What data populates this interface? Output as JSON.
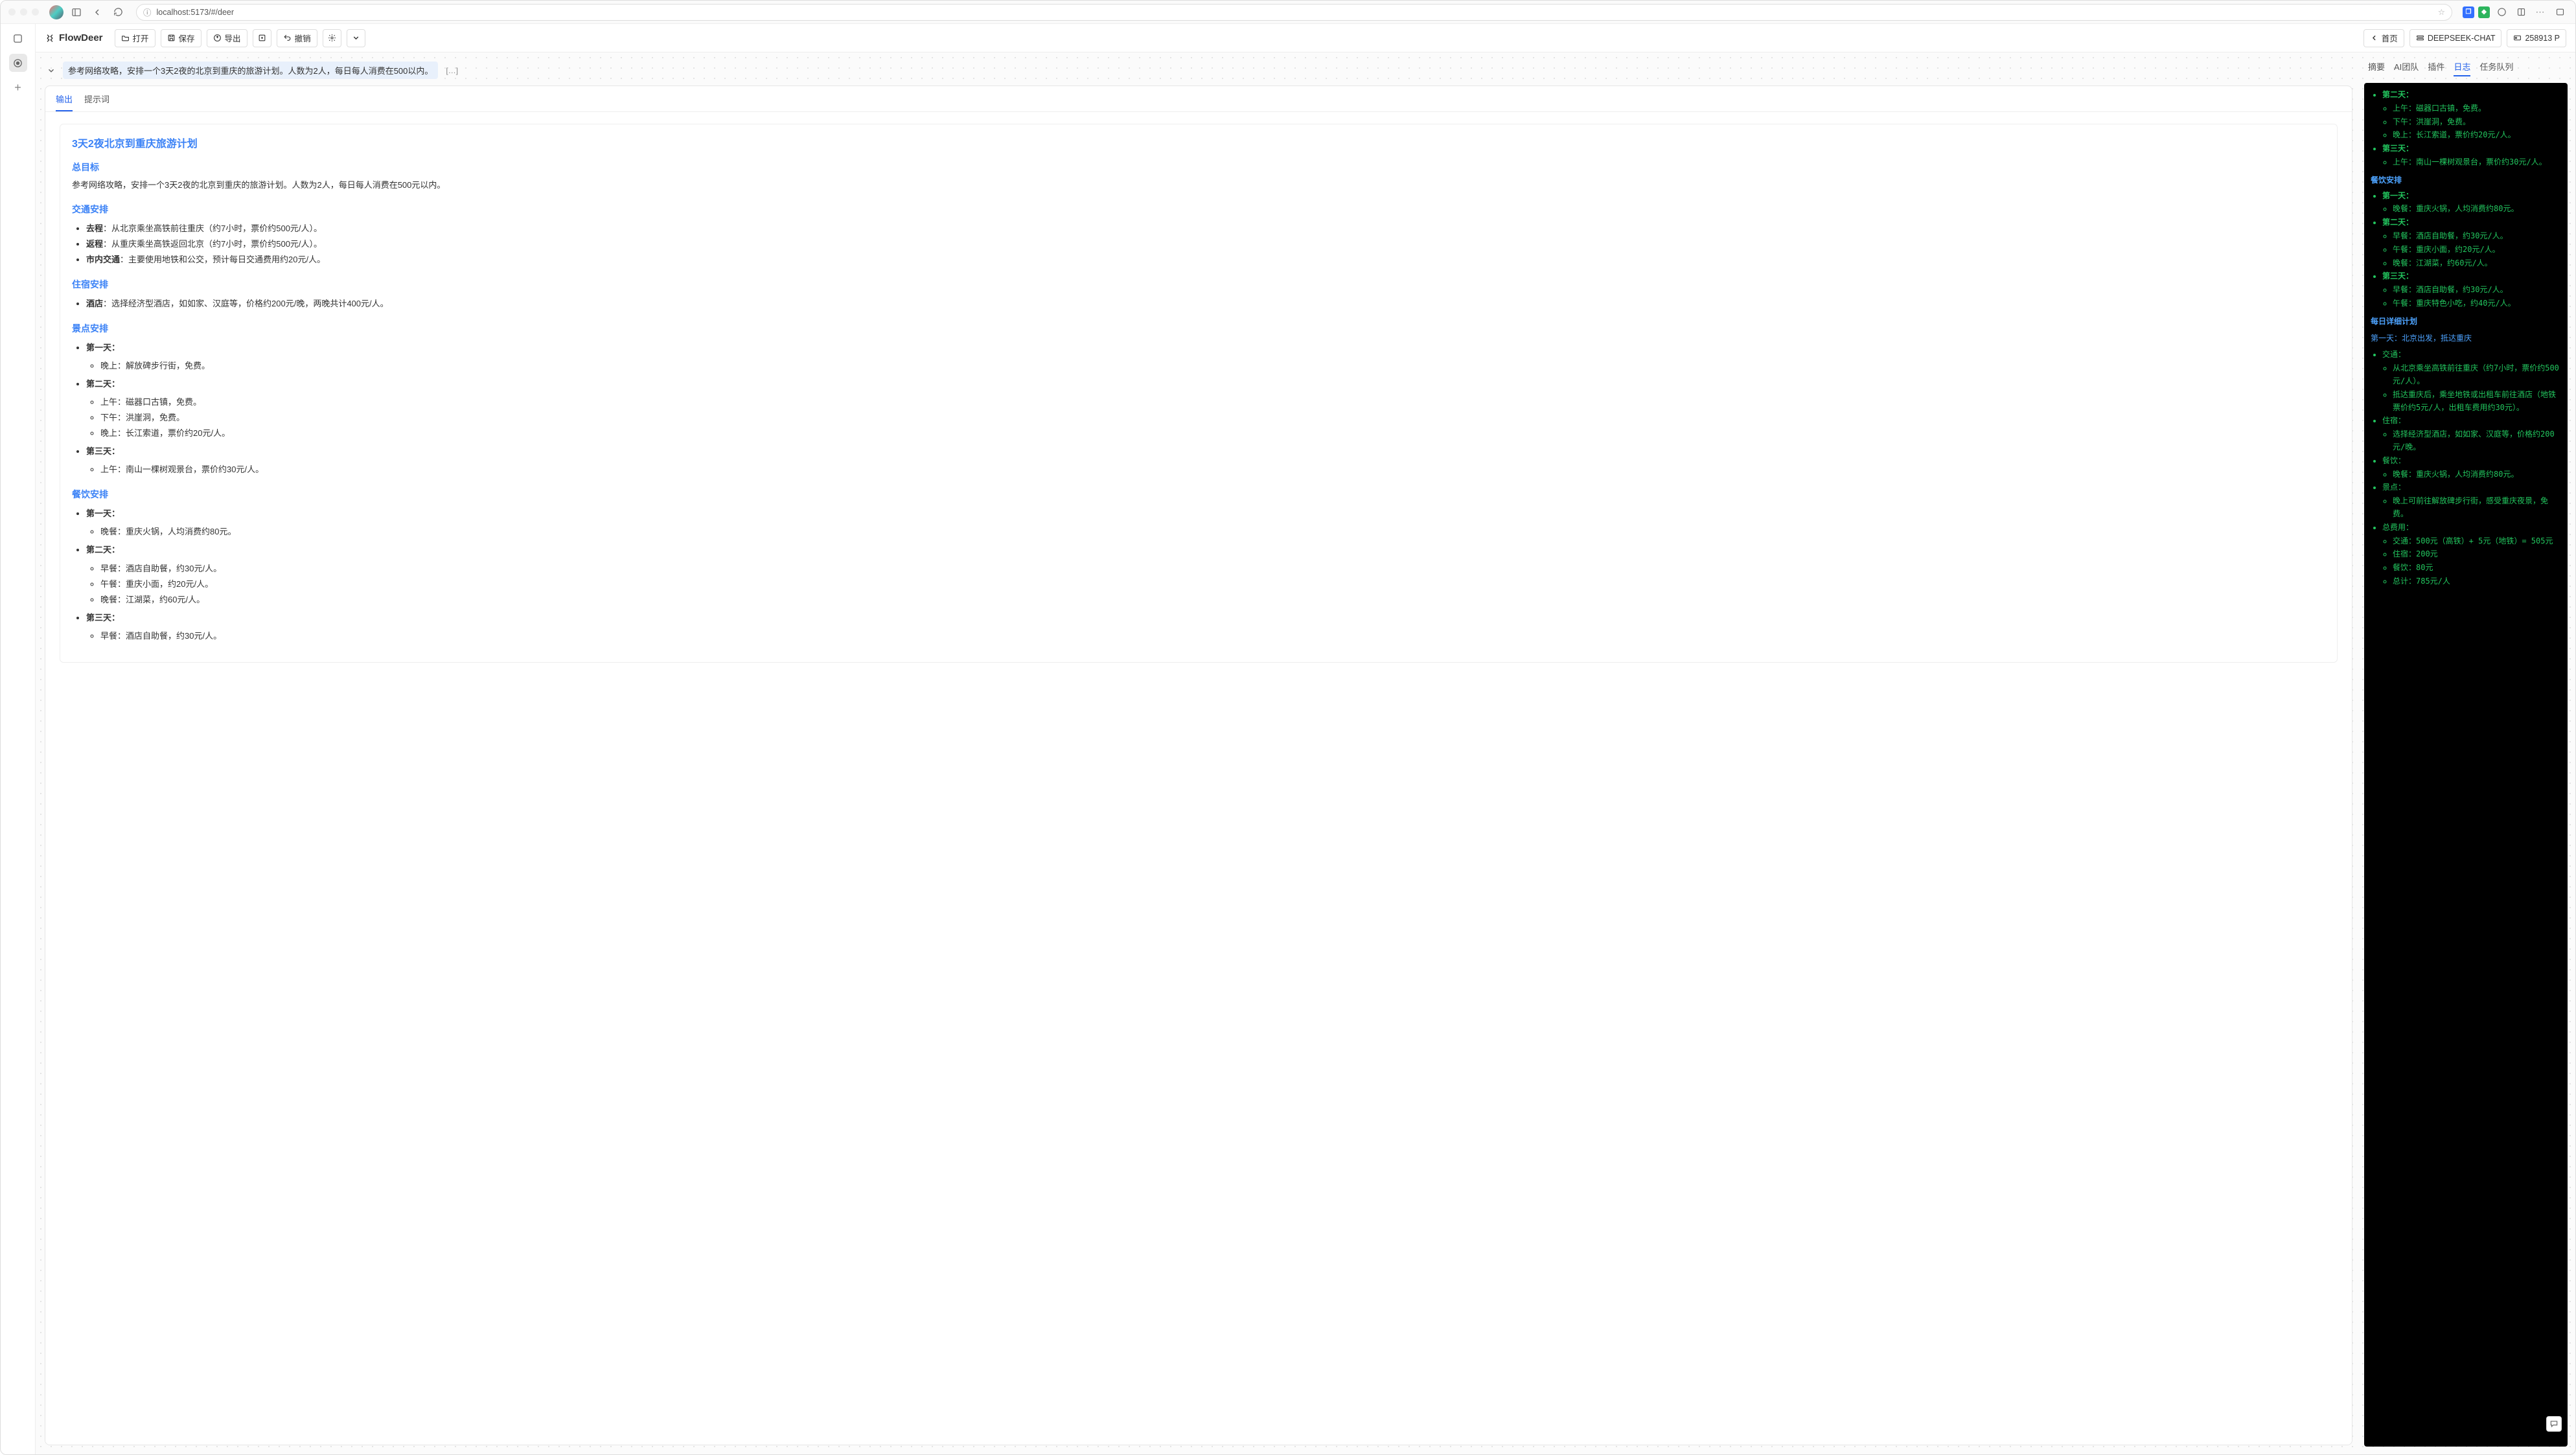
{
  "browser": {
    "url": "localhost:5173/#/deer"
  },
  "app": {
    "logo": "FlowDeer",
    "toolbar": {
      "open": "打开",
      "save": "保存",
      "export": "导出",
      "undo": "撤销"
    },
    "right_buttons": {
      "home": "首页",
      "model": "DEEPSEEK-CHAT",
      "points": "258913 P"
    }
  },
  "prompt": {
    "text": "参考网络攻略，安排一个3天2夜的北京到重庆的旅游计划。人数为2人，每日每人消费在500以内。",
    "suffix": "[…]"
  },
  "card_tabs": {
    "output": "输出",
    "prompt": "提示词"
  },
  "doc": {
    "title": "3天2夜北京到重庆旅游计划",
    "goal_h": "总目标",
    "goal_p": "参考网络攻略，安排一个3天2夜的北京到重庆的旅游计划。人数为2人，每日每人消费在500元以内。",
    "transport_h": "交通安排",
    "transport": [
      {
        "label": "去程",
        "text": "：从北京乘坐高铁前往重庆（约7小时，票价约500元/人）。"
      },
      {
        "label": "返程",
        "text": "：从重庆乘坐高铁返回北京（约7小时，票价约500元/人）。"
      },
      {
        "label": "市内交通",
        "text": "：主要使用地铁和公交，预计每日交通费用约20元/人。"
      }
    ],
    "lodging_h": "住宿安排",
    "lodging": [
      {
        "label": "酒店",
        "text": "：选择经济型酒店，如如家、汉庭等，价格约200元/晚，两晚共计400元/人。"
      }
    ],
    "sights_h": "景点安排",
    "sights": [
      {
        "day": "第一天：",
        "items": [
          "晚上：解放碑步行街，免费。"
        ]
      },
      {
        "day": "第二天：",
        "items": [
          "上午：磁器口古镇，免费。",
          "下午：洪崖洞，免费。",
          "晚上：长江索道，票价约20元/人。"
        ]
      },
      {
        "day": "第三天：",
        "items": [
          "上午：南山一棵树观景台，票价约30元/人。"
        ]
      }
    ],
    "food_h": "餐饮安排",
    "food": [
      {
        "day": "第一天：",
        "items": [
          "晚餐：重庆火锅，人均消费约80元。"
        ]
      },
      {
        "day": "第二天：",
        "items": [
          "早餐：酒店自助餐，约30元/人。",
          "午餐：重庆小面，约20元/人。",
          "晚餐：江湖菜，约60元/人。"
        ]
      },
      {
        "day": "第三天：",
        "items": [
          "早餐：酒店自助餐，约30元/人。"
        ]
      }
    ]
  },
  "side_tabs": {
    "summary": "摘要",
    "ai_team": "AI团队",
    "plugins": "插件",
    "log": "日志",
    "tasks": "任务队列"
  },
  "log": {
    "top_items": [
      {
        "day": "第二天：",
        "items": [
          "上午：磁器口古镇，免费。",
          "下午：洪崖洞，免费。",
          "晚上：长江索道，票价约20元/人。"
        ]
      },
      {
        "day": "第三天：",
        "items": [
          "上午：南山一棵树观景台，票价约30元/人。"
        ]
      }
    ],
    "food_h": "餐饮安排",
    "food": [
      {
        "day": "第一天：",
        "items": [
          "晚餐：重庆火锅，人均消费约80元。"
        ]
      },
      {
        "day": "第二天：",
        "items": [
          "早餐：酒店自助餐，约30元/人。",
          "午餐：重庆小面，约20元/人。",
          "晚餐：江湖菜，约60元/人。"
        ]
      },
      {
        "day": "第三天：",
        "items": [
          "早餐：酒店自助餐，约30元/人。",
          "午餐：重庆特色小吃，约40元/人。"
        ]
      }
    ],
    "daily_h": "每日详细计划",
    "day1_h": "第一天：北京出发，抵达重庆",
    "day1": [
      {
        "k": "交通：",
        "items": [
          "从北京乘坐高铁前往重庆（约7小时，票价约500元/人）。",
          "抵达重庆后，乘坐地铁或出租车前往酒店（地铁票价约5元/人，出租车费用约30元）。"
        ]
      },
      {
        "k": "住宿：",
        "items": [
          "选择经济型酒店，如如家、汉庭等，价格约200元/晚。"
        ]
      },
      {
        "k": "餐饮：",
        "items": [
          "晚餐：重庆火锅，人均消费约80元。"
        ]
      },
      {
        "k": "景点：",
        "items": [
          "晚上可前往解放碑步行街，感受重庆夜景，免费。"
        ]
      },
      {
        "k": "总费用：",
        "items": [
          "交通：500元（高铁）+ 5元（地铁）= 505元",
          "住宿：200元",
          "餐饮：80元",
          "总计：785元/人"
        ]
      }
    ]
  }
}
